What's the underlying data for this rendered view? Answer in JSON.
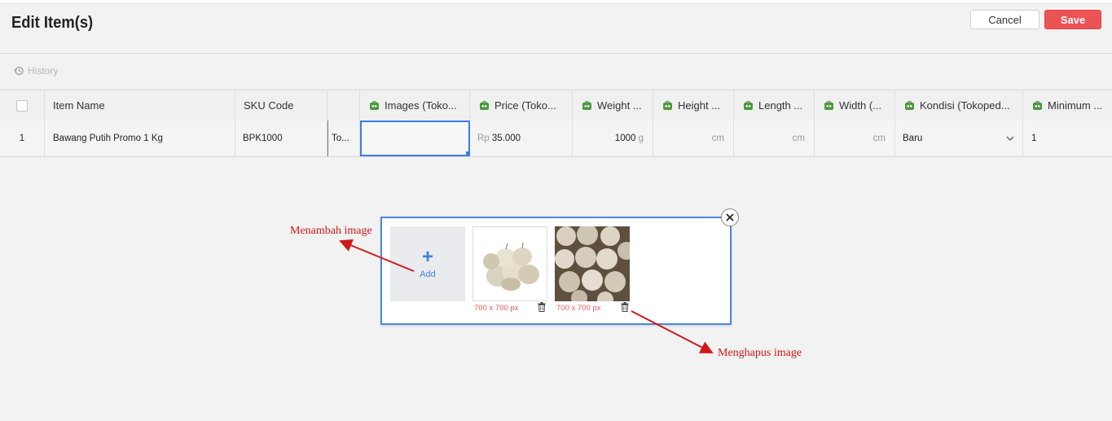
{
  "header": {
    "title": "Edit Item(s)",
    "cancel_label": "Cancel",
    "save_label": "Save"
  },
  "toolbar": {
    "history_label": "History"
  },
  "table": {
    "columns": [
      "Item Name",
      "SKU Code",
      "Images (Toko...",
      "Price (Toko...",
      "Weight ...",
      "Height ...",
      "Length ...",
      "Width (...",
      "Kondisi (Tokoped...",
      "Minimum ..."
    ],
    "rows": [
      {
        "index": "1",
        "item_name": "Bawang Putih Promo 1 Kg",
        "sku": "BPK1000",
        "store": "To...",
        "images": "",
        "price_prefix": "Rp",
        "price": "35.000",
        "weight": "1000",
        "weight_unit": "g",
        "height_unit": "cm",
        "length_unit": "cm",
        "width_unit": "cm",
        "kondisi": "Baru",
        "minimum": "1"
      }
    ]
  },
  "image_popup": {
    "add_label": "Add",
    "images": [
      {
        "size_label": "700 x 700 px"
      },
      {
        "size_label": "700 x 700 px"
      }
    ]
  },
  "annotations": {
    "add_note": "Menambah image",
    "delete_note": "Menghapus image"
  },
  "colors": {
    "accent": "#3d7ee0",
    "save": "#ec5355",
    "annotation": "#d01818"
  }
}
